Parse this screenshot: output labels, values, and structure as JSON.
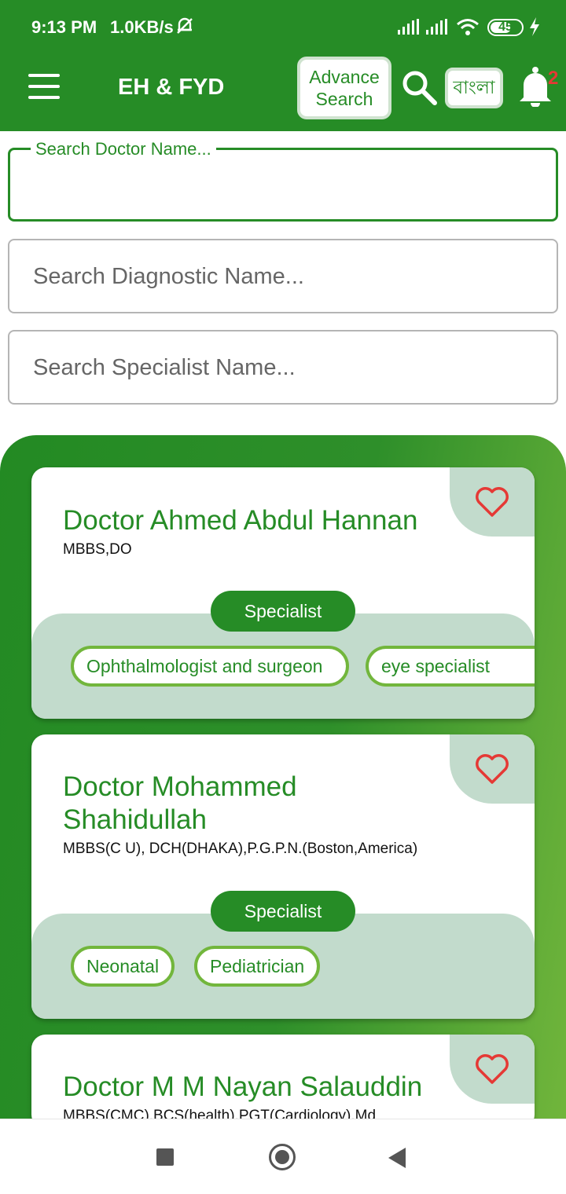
{
  "status_bar": {
    "time": "9:13 PM",
    "speed": "1.0KB/s",
    "battery": "45"
  },
  "app_bar": {
    "title": "EH & FYD",
    "advance_search_line1": "Advance",
    "advance_search_line2": "Search",
    "language_button": "বাংলা",
    "notification_count": "2"
  },
  "search": {
    "doctor_label": "Search Doctor Name...",
    "doctor_value": "",
    "diagnostic_placeholder": "Search Diagnostic Name...",
    "specialist_placeholder": "Search Specialist Name..."
  },
  "doctors": [
    {
      "name": "Doctor Ahmed Abdul Hannan",
      "degree": "MBBS,DO",
      "specialist_label": "Specialist",
      "specialties": [
        "Ophthalmologist and surgeon",
        "eye specialist"
      ]
    },
    {
      "name_line1": "Doctor Mohammed",
      "name_line2": "Shahidullah",
      "degree": "MBBS(C U), DCH(DHAKA),P.G.P.N.(Boston,America)",
      "specialist_label": "Specialist",
      "specialties": [
        "Neonatal",
        "Pediatrician"
      ]
    },
    {
      "name": "Doctor M M Nayan Salauddin",
      "degree": "MBBS(CMC),BCS(health),PGT(Cardiology),Md"
    }
  ],
  "colors": {
    "primary": "#268c26",
    "accent_light": "#72b63c",
    "panel": "#c2dbcc",
    "heart": "#e53935"
  },
  "icons": {
    "menu": "hamburger-icon",
    "search": "magnifier-icon",
    "notifications": "bell-icon",
    "favorite": "heart-outline-icon"
  }
}
